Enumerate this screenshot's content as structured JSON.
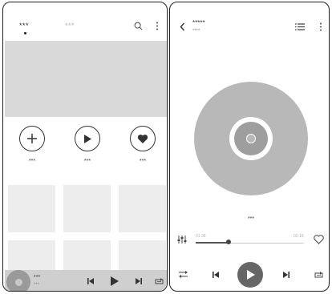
{
  "home": {
    "tabs": [
      {
        "label": "***",
        "active": true
      },
      {
        "label": "***",
        "active": false
      }
    ],
    "header_icons": [
      "search-icon",
      "more-vertical-icon"
    ],
    "quick_actions": [
      {
        "icon": "plus-icon",
        "label": "***"
      },
      {
        "icon": "play-icon",
        "label": "***"
      },
      {
        "icon": "heart-icon",
        "label": "***"
      }
    ],
    "mini_player": {
      "title": "***",
      "subtitle": "***",
      "controls": [
        "previous-icon",
        "play-icon",
        "next-icon",
        "repeat-icon"
      ]
    }
  },
  "player": {
    "title": "*****",
    "subtitle": "****",
    "header_icons": [
      "back-icon",
      "playlist-icon",
      "more-vertical-icon"
    ],
    "track_label": "***",
    "progress": {
      "elapsed": "01:38",
      "total": "02:18",
      "fraction": 0.3
    },
    "icons": [
      "equalizer-icon",
      "heart-outline-icon",
      "shuffle-icon",
      "previous-icon",
      "play-icon",
      "next-icon",
      "repeat-icon"
    ]
  }
}
